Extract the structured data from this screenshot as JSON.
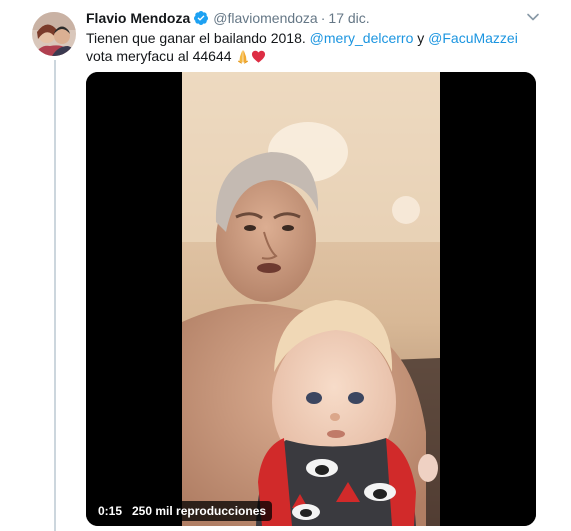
{
  "tweet": {
    "author_name": "Flavio Mendoza",
    "handle": "@flaviomendoza",
    "separator": "·",
    "date": "17 dic.",
    "text_part1": "Tienen que ganar el bailando 2018. ",
    "mention1": "@mery_delcerro",
    "text_part2": " y ",
    "mention2": "@FacuMazzei",
    "text_part3": "  vota meryfacu al 44644 ",
    "icons": [
      "verified-badge-icon",
      "chevron-down-icon",
      "folded-hands-emoji",
      "red-heart-emoji"
    ],
    "accent_color": "#1b95e0"
  },
  "video": {
    "duration": "0:15",
    "views": "250 mil reproducciones"
  }
}
